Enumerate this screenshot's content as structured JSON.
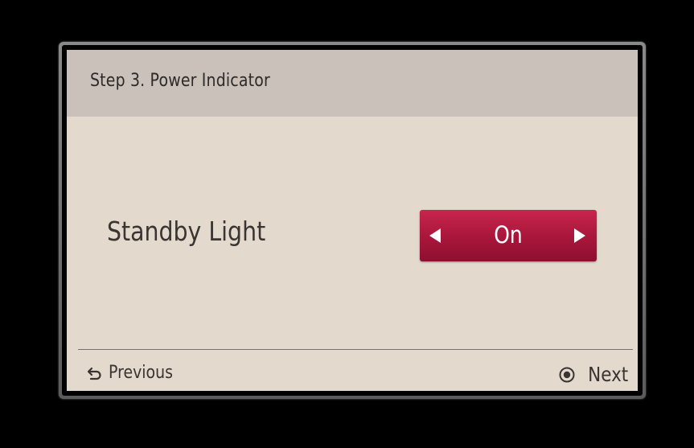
{
  "dialog": {
    "title": "Step 3. Power Indicator",
    "setting": {
      "label": "Standby Light",
      "value": "On",
      "left_icon": "arrow-left-icon",
      "right_icon": "arrow-right-icon"
    },
    "footer": {
      "previous_label": "Previous",
      "previous_icon": "back-icon",
      "next_label": "Next",
      "next_icon": "ok-button-icon"
    }
  },
  "colors": {
    "background": "#000000",
    "panel": "#e3d9cd",
    "header": "#c9c1ba",
    "selector": "#a8163b",
    "text": "#3a3532"
  }
}
